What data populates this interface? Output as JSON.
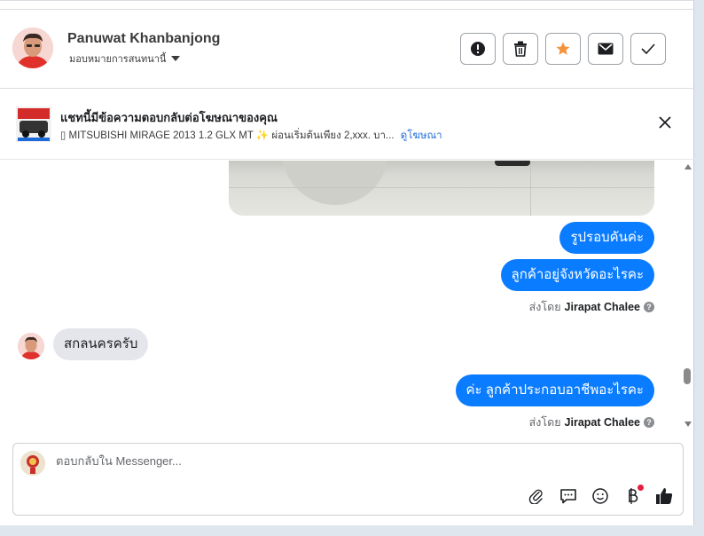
{
  "contact": {
    "name": "Panuwat Khanbanjong",
    "assign_label": "มอบหมายการสนทนานี้"
  },
  "header_actions": [
    {
      "name": "spam-button",
      "icon": "alert-circle-icon"
    },
    {
      "name": "delete-button",
      "icon": "trash-icon"
    },
    {
      "name": "star-button",
      "icon": "star-icon",
      "color": "#f5933b"
    },
    {
      "name": "mark-unread-button",
      "icon": "envelope-icon"
    },
    {
      "name": "mark-done-button",
      "icon": "check-icon"
    }
  ],
  "ad_banner": {
    "title": "แชทนี้มีข้อความตอบกลับต่อโฆษณาของคุณ",
    "subtitle": "▯ MITSUBISHI MIRAGE 2013 1.2 GLX MT ✨ ผ่อนเริ่มต้นเพียง 2,xxx. บา...",
    "link": "ดูโฆษณา"
  },
  "messages": [
    {
      "direction": "out",
      "text": "รูปรอบคันค่ะ"
    },
    {
      "direction": "out",
      "text": "ลูกค้าอยู่จังหวัดอะไรคะ"
    },
    {
      "direction": "in",
      "text": "สกลนครครับ"
    },
    {
      "direction": "out",
      "text": "ค่ะ ลูกค้าประกอบอาชีพอะไรคะ"
    }
  ],
  "sent_by": {
    "prefix": "ส่งโดย",
    "agent": "Jirapat Chalee"
  },
  "composer": {
    "placeholder": "ตอบกลับใน Messenger..."
  },
  "colors": {
    "outgoing_bubble": "#0a7cff",
    "incoming_bubble": "#e4e6eb",
    "link": "#216fdb"
  }
}
